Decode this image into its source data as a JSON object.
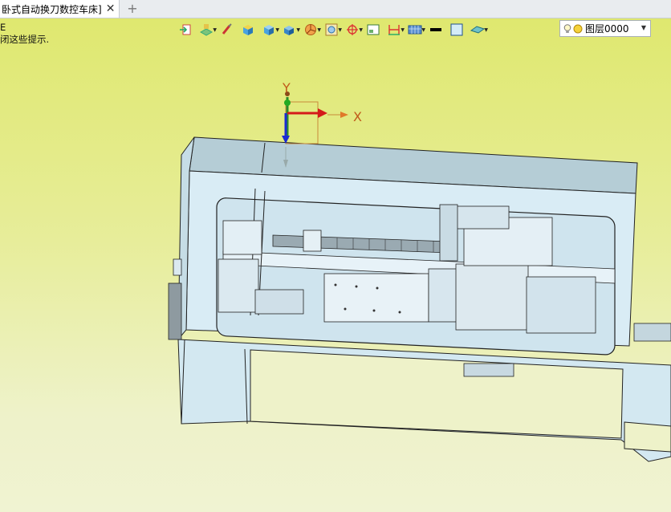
{
  "tab": {
    "label": "卧式自动换刀数控车床]",
    "close": "✕",
    "new": "+"
  },
  "hint": {
    "line1": "E",
    "line2": "闭这些提示."
  },
  "toolbar": {
    "items": [
      "import-icon",
      "layer-tools-icon",
      "brush-icon",
      "box-color-icon",
      "solid-box-icon",
      "render-icon",
      "pie-style-icon",
      "view-frame-icon",
      "target-icon",
      "single-view-icon",
      "dimension-icon",
      "display-mode-icon",
      "line-color-icon",
      "fill-color-icon",
      "plane-icon"
    ]
  },
  "layer": {
    "value": "图层0000"
  },
  "axes": {
    "x_label": "X",
    "y_label": "Y"
  },
  "colors": {
    "model_fill": "#d9ecf5",
    "model_dark": "#a9c2cc",
    "edge": "#222222",
    "viewport_top": "#dfe86f"
  }
}
